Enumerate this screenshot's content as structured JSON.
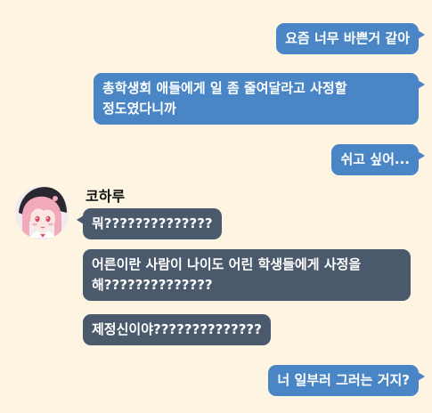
{
  "chat": {
    "sender_name": "코하루",
    "messages": [
      {
        "side": "me",
        "text": "요즘 너무 바쁜거 같아"
      },
      {
        "side": "me",
        "text": "총학생회 애들에게 일 좀 줄여달라고 사정할 정도였다니까"
      },
      {
        "side": "me",
        "text": "쉬고 싶어..."
      },
      {
        "side": "other",
        "text": "뭐??????????????"
      },
      {
        "side": "other",
        "text": "어른이란 사람이 나이도 어린 학생들에게 사정을 해??????????????"
      },
      {
        "side": "other",
        "text": "제정신이야??????????????"
      },
      {
        "side": "me",
        "text": "너 일부러 그러는 거지?"
      }
    ]
  },
  "colors": {
    "background": "#fdf5e1",
    "my_bubble": "#4a86c6",
    "their_bubble": "#4b596c"
  },
  "icons": {
    "avatar": "pink-haired-character-avatar"
  }
}
